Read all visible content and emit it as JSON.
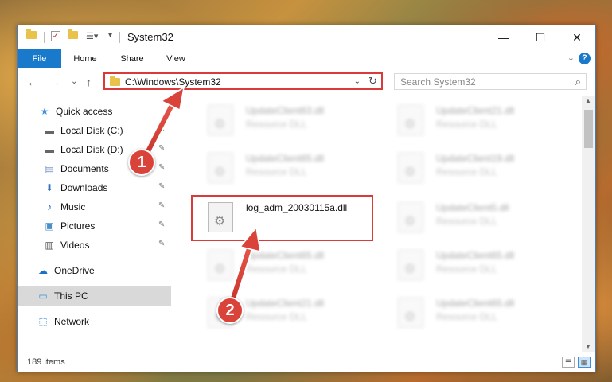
{
  "window": {
    "title": "System32",
    "minimize_glyph": "—",
    "maximize_glyph": "☐",
    "close_glyph": "✕"
  },
  "ribbon": {
    "tabs": [
      "File",
      "Home",
      "Share",
      "View"
    ],
    "help_glyph": "?",
    "collapse_glyph": "⌄"
  },
  "nav": {
    "back_glyph": "←",
    "forward_glyph": "→",
    "recent_glyph": "⌄",
    "up_glyph": "↑",
    "address": "C:\\Windows\\System32",
    "address_drop_glyph": "⌄",
    "refresh_glyph": "↻",
    "search_placeholder": "Search System32",
    "search_glyph": "⌕"
  },
  "sidebar": {
    "items": [
      {
        "label": "Quick access",
        "icon": "★"
      },
      {
        "label": "Local Disk (C:)",
        "icon": "▬",
        "pinned": true
      },
      {
        "label": "Local Disk (D:)",
        "icon": "▬",
        "pinned": true
      },
      {
        "label": "Documents",
        "icon": "▤",
        "pinned": true
      },
      {
        "label": "Downloads",
        "icon": "⬇",
        "pinned": true
      },
      {
        "label": "Music",
        "icon": "♪",
        "pinned": true
      },
      {
        "label": "Pictures",
        "icon": "▣",
        "pinned": true
      },
      {
        "label": "Videos",
        "icon": "▥",
        "pinned": true
      },
      {
        "label": "OneDrive",
        "icon": "☁"
      },
      {
        "label": "This PC",
        "icon": "▭"
      },
      {
        "label": "Network",
        "icon": "⬚"
      }
    ],
    "pin_glyph": "✎"
  },
  "files": [
    {
      "name": "UpdateClient63.dll",
      "type": "Resource DLL"
    },
    {
      "name": "UpdateClient21.dll",
      "type": "Resource DLL"
    },
    {
      "name": "UpdateClient65.dll",
      "type": "Resource DLL"
    },
    {
      "name": "UpdateClient19.dll",
      "type": "Resource DLL"
    },
    {
      "name": "log_adm_20030115a.dll",
      "type": ""
    },
    {
      "name": "UpdateClient5.dll",
      "type": "Resource DLL"
    },
    {
      "name": "UpdateClient65.dll",
      "type": "Resource DLL"
    },
    {
      "name": "UpdateClient65.dll",
      "type": "Resource DLL"
    },
    {
      "name": "UpdateClient21.dll",
      "type": "Resource DLL"
    },
    {
      "name": "UpdateClient65.dll",
      "type": "Resource DLL"
    }
  ],
  "status": {
    "item_count": "189 items"
  },
  "callouts": [
    "1",
    "2"
  ],
  "colors": {
    "accent": "#1979ca",
    "highlight_red": "#d93a3a",
    "badge_red": "#d9433a"
  }
}
